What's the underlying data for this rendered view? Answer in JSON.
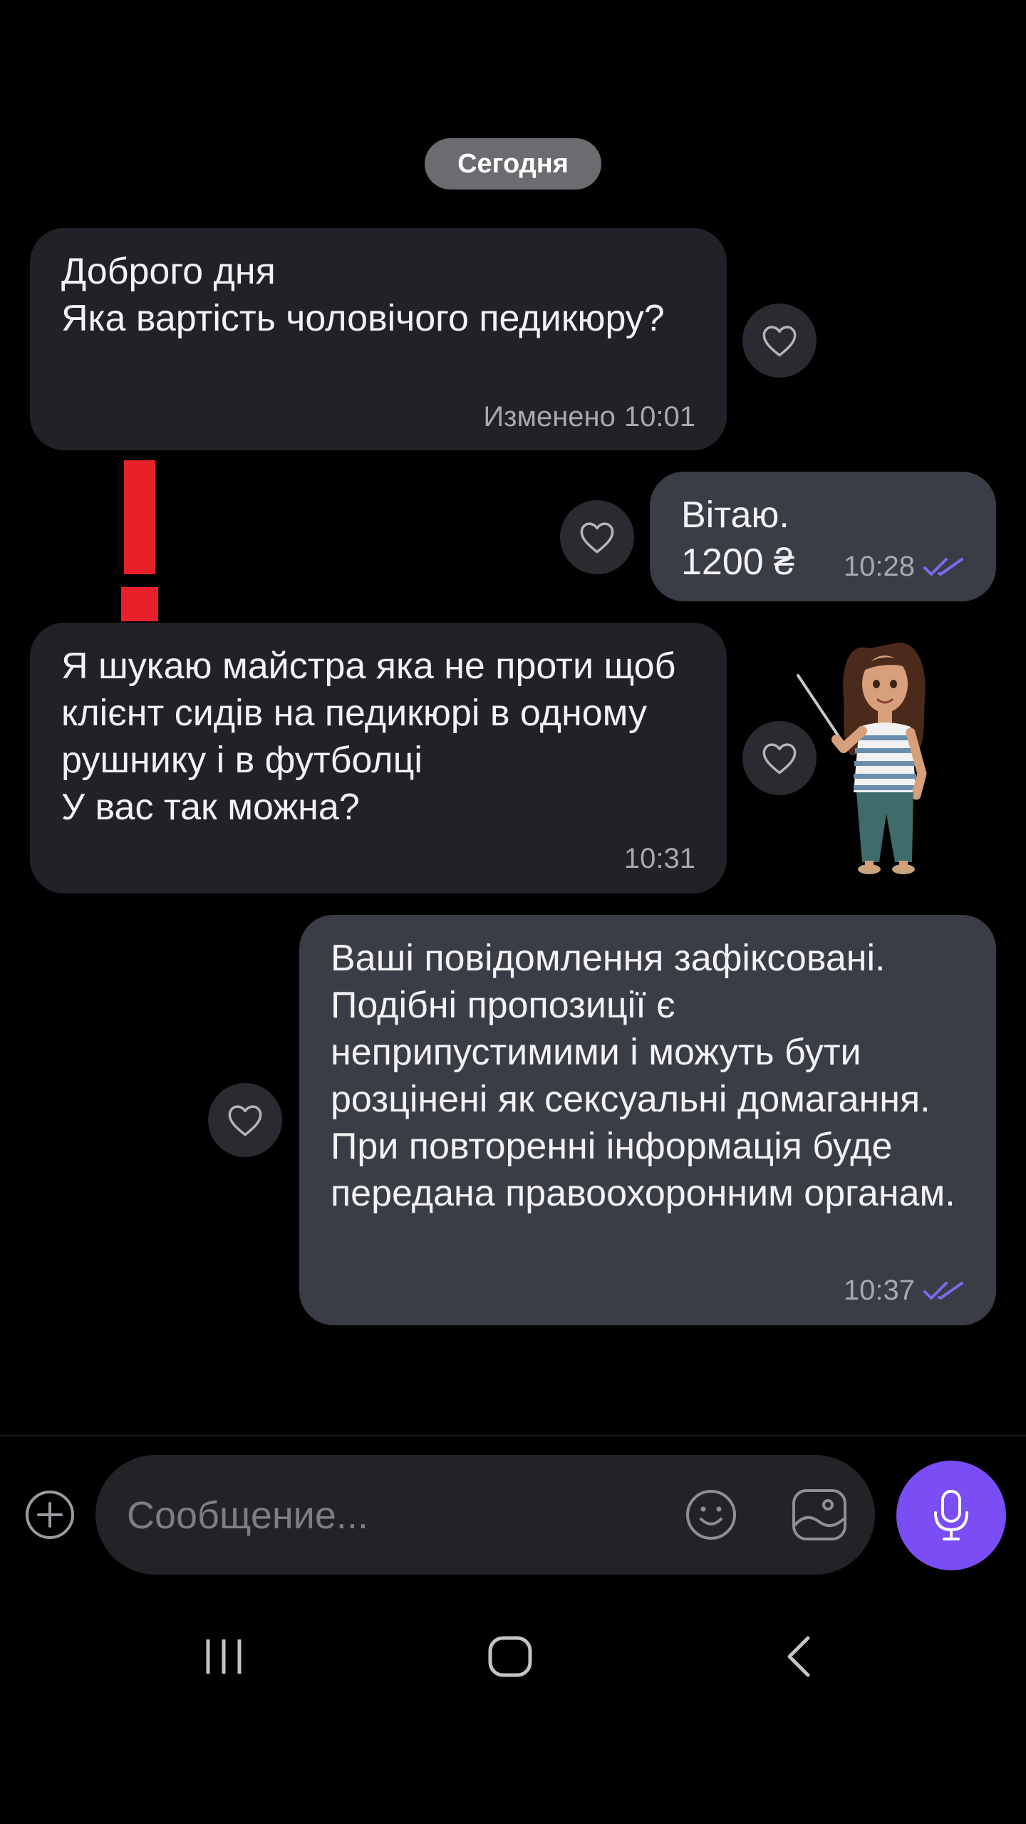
{
  "date_separator": "Сегодня",
  "messages": [
    {
      "direction": "in",
      "text": "Доброго дня\nЯка вартість чоловічого педикюру?",
      "edited_label": "Изменено",
      "time": "10:01"
    },
    {
      "direction": "out",
      "text": "Вітаю.\n1200 ₴",
      "time": "10:28",
      "status": "read"
    },
    {
      "direction": "in",
      "text": "Я шукаю майстра яка не проти щоб клієнт сидів на педикюрі в одному рушнику і в футболці\nУ вас так можна?",
      "time": "10:31"
    },
    {
      "direction": "out",
      "text": "Ваші повідомлення зафіксовані. Подібні пропозиції є неприпустимими і можуть бути розцінені як сексуальні домагання. При повторенні інформація буде передана правоохоронним органам.",
      "time": "10:37",
      "status": "read"
    }
  ],
  "composer": {
    "placeholder": "Сообщение...",
    "value": ""
  },
  "icons": {
    "react": "heart-icon",
    "read_status": "double-check-icon",
    "attach": "plus-circle-icon",
    "emoji": "smiley-icon",
    "gallery": "image-icon",
    "record": "microphone-icon",
    "nav_recents": "recents-icon",
    "nav_home": "home-icon",
    "nav_back": "back-icon"
  },
  "colors": {
    "background": "#000000",
    "incoming_bubble": "#212228",
    "outgoing_bubble": "#3a3d46",
    "accent": "#7b4df4",
    "read_check": "#7a6cf0",
    "exclamation": "#e8202a"
  }
}
